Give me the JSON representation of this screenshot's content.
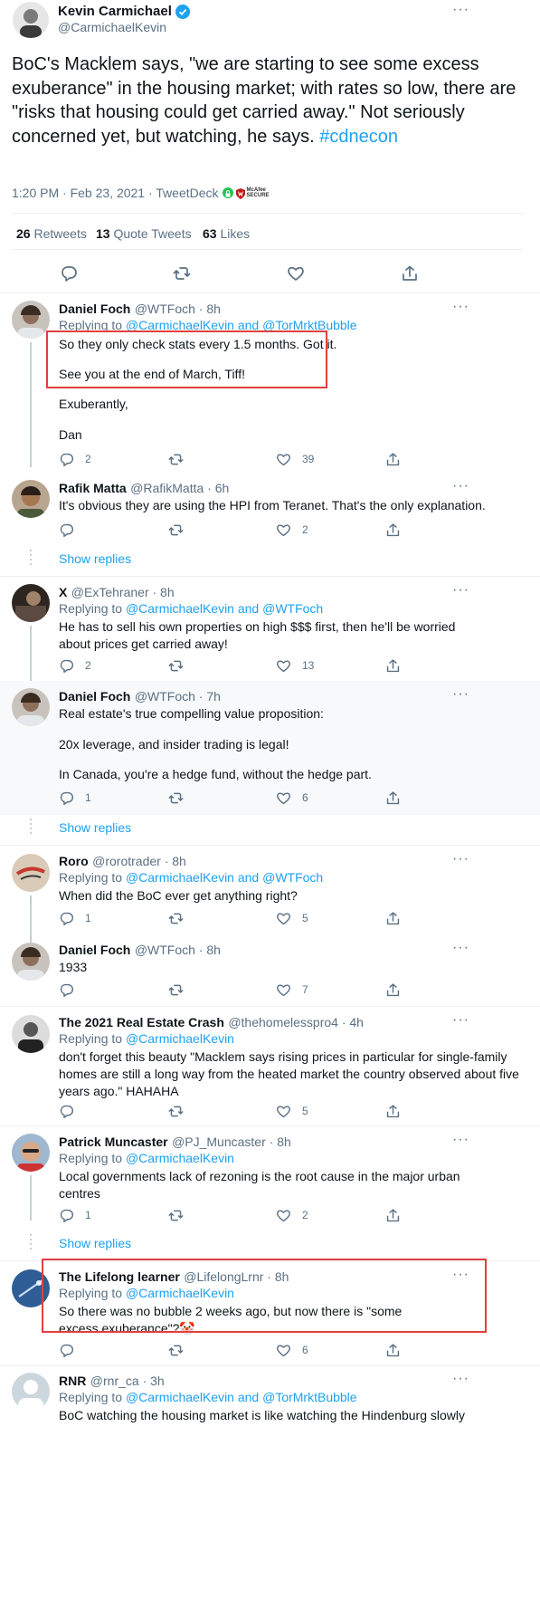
{
  "main": {
    "author_name": "Kevin Carmichael",
    "author_handle": "@CarmichaelKevin",
    "text": "BoC's Macklem says, \"we are starting to see some excess exuberance\" in the housing market; with rates so low, there are \"risks that housing could get carried away.\" Not seriously concerned yet, but watching, he says.",
    "hashtag": "#cdnecon",
    "meta": "1:20 PM · Feb 23, 2021 · TweetDeck",
    "mcafee_badge": "McAfee SECURE",
    "retweets": "26",
    "retweets_label": "Retweets",
    "quotes": "13",
    "quotes_label": "Quote Tweets",
    "likes": "63",
    "likes_label": "Likes"
  },
  "more_glyph": "···",
  "show_replies": "Show replies",
  "replies": [
    {
      "name": "Daniel Foch",
      "handle": "@WTFoch · 8h",
      "replying_prefix": "Replying to",
      "replying_to": "@CarmichaelKevin and @TorMrktBubble",
      "text": [
        "So they only check stats every 1.5 months. Got it.",
        "See you at the end of March, Tiff!",
        "Exuberantly,",
        "Dan"
      ],
      "replies": "2",
      "likes": "39"
    },
    {
      "name": "Rafik Matta",
      "handle": "@RafikMatta · 6h",
      "text": [
        "It's obvious they are using the HPI from Teranet. That's the only explanation."
      ],
      "likes": "2"
    },
    {
      "name": "X",
      "handle": "@ExTehraner · 8h",
      "replying_prefix": "Replying to",
      "replying_to": "@CarmichaelKevin and @WTFoch",
      "text": [
        "He has to sell his own properties on high $$$ first, then he'll be worried about prices get carried away!"
      ],
      "replies": "2",
      "likes": "13"
    },
    {
      "name": "Daniel Foch",
      "handle": "@WTFoch · 7h",
      "text": [
        "Real estate's true compelling value proposition:",
        "20x leverage, and insider trading is legal!",
        "In Canada, you're a hedge fund, without the hedge part."
      ],
      "replies": "1",
      "likes": "6"
    },
    {
      "name": "Roro",
      "handle": "@rorotrader · 8h",
      "replying_prefix": "Replying to",
      "replying_to": "@CarmichaelKevin and @WTFoch",
      "text": [
        "When did the BoC ever get anything right?"
      ],
      "replies": "1",
      "likes": "5"
    },
    {
      "name": "Daniel Foch",
      "handle": "@WTFoch · 8h",
      "text": [
        "1933"
      ],
      "likes": "7"
    },
    {
      "name": "The 2021 Real Estate Crash",
      "handle": "@thehomelesspro4 · 4h",
      "replying_prefix": "Replying to",
      "replying_to": "@CarmichaelKevin",
      "text": [
        "don't forget this beauty \"Macklem says rising prices in particular for single-family homes are still a long way from the heated market the country observed about five years ago.\" HAHAHA"
      ],
      "likes": "5"
    },
    {
      "name": "Patrick Muncaster",
      "handle": "@PJ_Muncaster · 8h",
      "replying_prefix": "Replying to",
      "replying_to": "@CarmichaelKevin",
      "text": [
        "Local governments lack of rezoning is the root cause in the major urban centres"
      ],
      "replies": "1",
      "likes": "2"
    },
    {
      "name": "The Lifelong learner",
      "handle": "@LifelongLrnr · 8h",
      "replying_prefix": "Replying to",
      "replying_to": "@CarmichaelKevin",
      "text": [
        "So there was no bubble 2 weeks ago, but now there is \"some excess exuberance\"?🤡"
      ],
      "likes": "6"
    },
    {
      "name": "RNR",
      "handle": "@rnr_ca · 3h",
      "replying_prefix": "Replying to",
      "replying_to": "@CarmichaelKevin and @TorMrktBubble",
      "text": [
        "BoC watching the housing market is like watching the Hindenburg slowly"
      ]
    }
  ]
}
